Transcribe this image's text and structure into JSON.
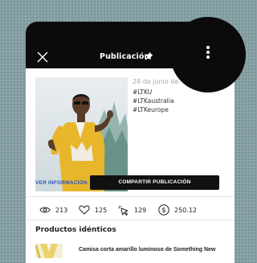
{
  "header": {
    "title": "Publicación",
    "close_icon": "close-icon",
    "pin_icon": "pin-icon",
    "menu_icon": "more-vertical-icon"
  },
  "post": {
    "date": "28 de junio de",
    "tags": [
      "#LTKU",
      "#LTKaustralia",
      "#LTKeurope"
    ]
  },
  "actions": {
    "details_label": "VER INFORMACIÓN",
    "share_label": "COMPARTIR PUBLICACIÓN"
  },
  "stats": [
    {
      "icon": "eye-icon",
      "value": "213"
    },
    {
      "icon": "heart-icon",
      "value": "125"
    },
    {
      "icon": "cursor-click-icon",
      "value": "129"
    },
    {
      "icon": "dollar-icon",
      "value": "250.12"
    }
  ],
  "products": {
    "title": "Productos idénticos",
    "items": [
      {
        "name": "Camisa corta amarillo luminoso de Something New"
      }
    ]
  },
  "colors": {
    "header_bg": "#0b0b0b",
    "link": "#2c53b8",
    "button_bg": "#111111"
  }
}
